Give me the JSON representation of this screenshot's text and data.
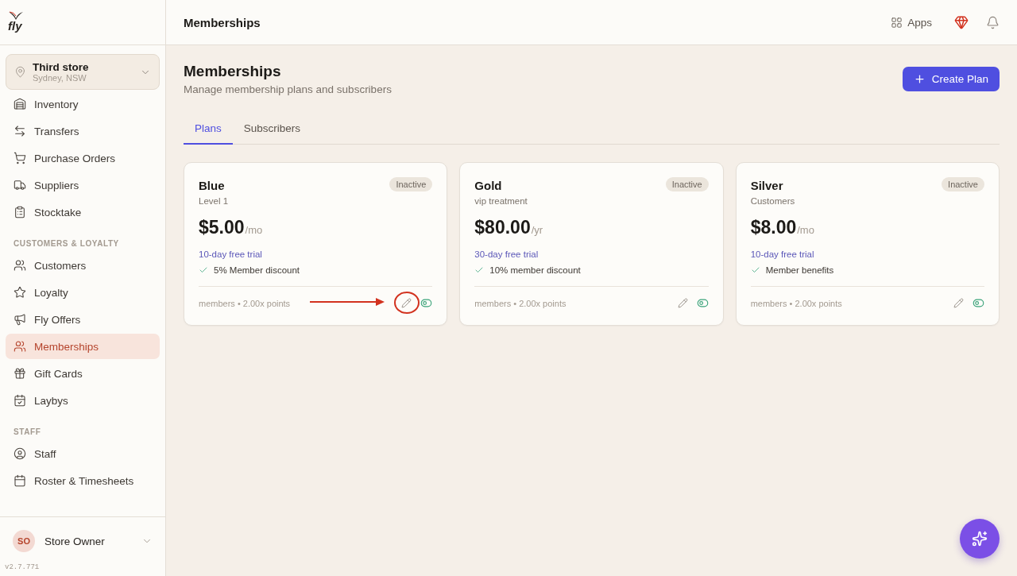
{
  "brand": {
    "logo_text": "fly"
  },
  "store": {
    "name": "Third store",
    "location": "Sydney, NSW"
  },
  "sidebar": {
    "sections": [
      {
        "items": [
          {
            "label": "Inventory",
            "selected": false
          },
          {
            "label": "Transfers",
            "selected": false
          },
          {
            "label": "Purchase Orders",
            "selected": false
          },
          {
            "label": "Suppliers",
            "selected": false
          },
          {
            "label": "Stocktake",
            "selected": false
          }
        ]
      },
      {
        "heading": "CUSTOMERS & LOYALTY",
        "items": [
          {
            "label": "Customers",
            "selected": false
          },
          {
            "label": "Loyalty",
            "selected": false
          },
          {
            "label": "Fly Offers",
            "selected": false
          },
          {
            "label": "Memberships",
            "selected": true
          },
          {
            "label": "Gift Cards",
            "selected": false
          },
          {
            "label": "Laybys",
            "selected": false
          }
        ]
      },
      {
        "heading": "STAFF",
        "items": [
          {
            "label": "Staff",
            "selected": false
          },
          {
            "label": "Roster & Timesheets",
            "selected": false
          }
        ]
      }
    ]
  },
  "user": {
    "initials": "SO",
    "name": "Store Owner"
  },
  "version": "v2.7.771",
  "header": {
    "title": "Memberships",
    "apps_label": "Apps"
  },
  "page": {
    "title": "Memberships",
    "subtitle": "Manage membership plans and subscribers",
    "create_button": "Create Plan"
  },
  "tabs": [
    {
      "label": "Plans",
      "selected": true
    },
    {
      "label": "Subscribers",
      "selected": false
    }
  ],
  "plans": [
    {
      "name": "Blue",
      "description": "Level 1",
      "status": "Inactive",
      "price": "$5.00",
      "period": "/mo",
      "trial": "10-day free trial",
      "benefit": "5% Member discount",
      "footer": "members • 2.00x points",
      "highlighted": true
    },
    {
      "name": "Gold",
      "description": "vip treatment",
      "status": "Inactive",
      "price": "$80.00",
      "period": "/yr",
      "trial": "30-day free trial",
      "benefit": "10% member discount",
      "footer": "members • 2.00x points",
      "highlighted": false
    },
    {
      "name": "Silver",
      "description": "Customers",
      "status": "Inactive",
      "price": "$8.00",
      "period": "/mo",
      "trial": "10-day free trial",
      "benefit": "Member benefits",
      "footer": "members • 2.00x points",
      "highlighted": false
    }
  ]
}
